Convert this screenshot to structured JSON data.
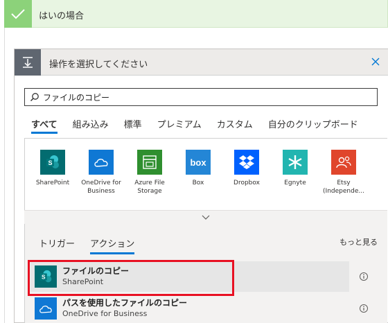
{
  "branch": {
    "title": "はいの場合"
  },
  "card": {
    "title": "操作を選択してください"
  },
  "search": {
    "value": "ファイルのコピー"
  },
  "tabs": [
    "すべて",
    "組み込み",
    "標準",
    "プレミアム",
    "カスタム",
    "自分のクリップボード"
  ],
  "active_tab": "すべて",
  "connectors": [
    {
      "label": "SharePoint",
      "color": "#036c70",
      "icon": "sharepoint-icon"
    },
    {
      "label": "OneDrive for Business",
      "color": "#0f78d4",
      "icon": "cloud-icon"
    },
    {
      "label": "Azure File Storage",
      "color": "#2f8f2f",
      "icon": "file-storage-icon"
    },
    {
      "label": "Box",
      "color": "#2486d6",
      "icon": "box-icon"
    },
    {
      "label": "Dropbox",
      "color": "#0061fe",
      "icon": "dropbox-icon"
    },
    {
      "label": "Egnyte",
      "color": "#22b5b0",
      "icon": "egnyte-icon"
    },
    {
      "label": "Etsy (Independe...",
      "color": "#e0462c",
      "icon": "etsy-icon"
    }
  ],
  "subtabs": [
    "トリガー",
    "アクション"
  ],
  "active_subtab": "アクション",
  "see_more": "もっと見る",
  "actions": [
    {
      "title": "ファイルのコピー",
      "subtitle": "SharePoint",
      "color": "#036c70"
    },
    {
      "title": "パスを使用したファイルのコピー",
      "subtitle": "OneDrive for Business",
      "color": "#0f78d4"
    }
  ]
}
